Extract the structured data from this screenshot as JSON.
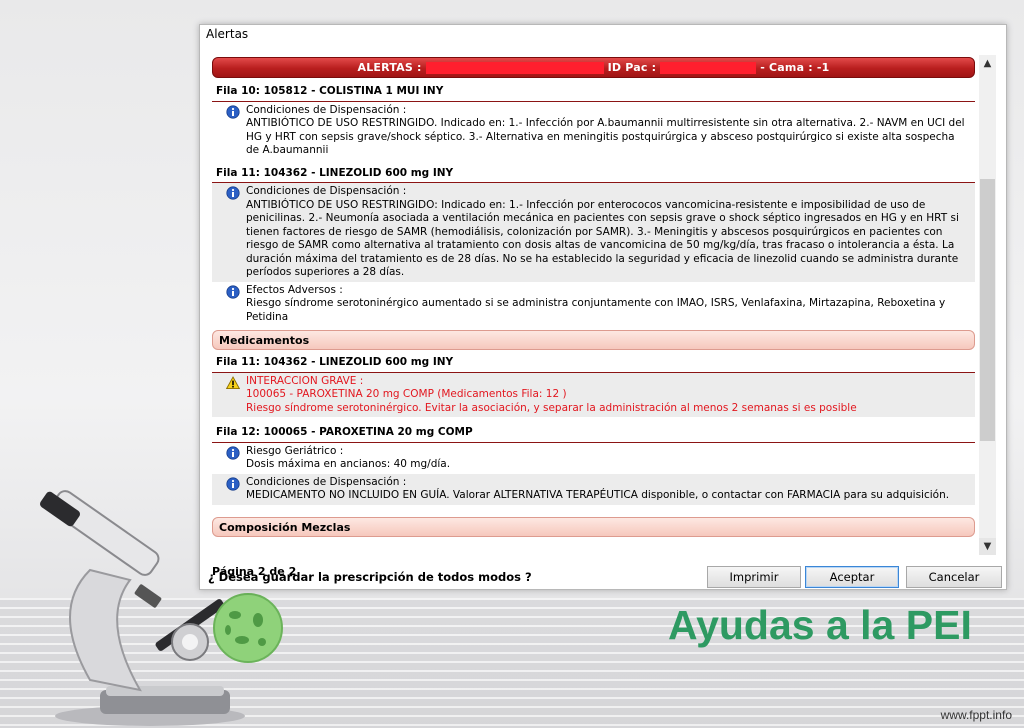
{
  "window": {
    "title": "Alertas"
  },
  "banner": {
    "alertas_label": "ALERTAS :",
    "id_pac_label": "ID Pac :",
    "cama_label": "- Cama : -1"
  },
  "blocks": {
    "fila10": {
      "header": "Fila 10: 105812 - COLISTINA 1 MUI INY",
      "condiciones_title": "Condiciones de Dispensación :",
      "condiciones_text": "ANTIBIÓTICO DE USO RESTRINGIDO. Indicado en: 1.- Infección por A.baumannii multirresistente sin otra alternativa. 2.- NAVM en UCI del HG y HRT con sepsis grave/shock séptico. 3.- Alternativa en meningitis postquirúrgica y absceso postquirúrgico si existe alta sospecha de A.baumannii"
    },
    "fila11": {
      "header": "Fila 11: 104362 - LINEZOLID 600 mg INY",
      "condiciones_title": "Condiciones de Dispensación :",
      "condiciones_text": "ANTIBIÓTICO DE USO RESTRINGIDO: Indicado en: 1.- Infección por enterococos vancomicina-resistente e imposibilidad de uso de penicilinas. 2.- Neumonía asociada a ventilación mecánica en pacientes con sepsis grave o shock séptico ingresados en HG y en HRT si tienen factores de riesgo de SAMR (hemodiálisis, colonización por SAMR). 3.- Meningitis y abscesos posquirúrgicos en pacientes con riesgo de SAMR como alternativa al tratamiento con dosis altas de vancomicina de 50 mg/kg/día, tras fracaso o intolerancia a ésta. La duración máxima del tratamiento es de 28 días. No se ha establecido la seguridad y eficacia de linezolid cuando se administra durante períodos superiores a 28 días.",
      "efectos_title": "Efectos Adversos :",
      "efectos_text": "Riesgo síndrome serotoninérgico aumentado si se administra conjuntamente con IMAO, ISRS, Venlafaxina, Mirtazapina, Reboxetina y Petidina"
    },
    "medicamentos_section": "Medicamentos",
    "med_fila11": {
      "header": "Fila 11: 104362 - LINEZOLID 600 mg INY",
      "interaccion_title": "INTERACCION GRAVE :",
      "interaccion_line1": "100065 - PAROXETINA 20 mg COMP (Medicamentos Fila: 12 )",
      "interaccion_line2": "Riesgo síndrome serotoninérgico. Evitar la asociación, y separar la administración al menos 2 semanas si es posible"
    },
    "med_fila12": {
      "header": "Fila 12: 100065 - PAROXETINA 20 mg COMP",
      "riesgo_title": "Riesgo Geriátrico :",
      "riesgo_text": "Dosis máxima en ancianos: 40 mg/día.",
      "condiciones_title": "Condiciones de Dispensación :",
      "condiciones_text": "MEDICAMENTO NO INCLUIDO EN GUÍA. Valorar ALTERNATIVA TERAPÉUTICA disponible, o contactar con FARMACIA para su adquisición."
    },
    "composicion_section": "Composición Mezclas"
  },
  "pagination": "Página 2 de 2",
  "question": "¿ Desea guardar la prescripción de todos modos ?",
  "buttons": {
    "imprimir": "Imprimir",
    "aceptar": "Aceptar",
    "cancelar": "Cancelar"
  },
  "slide": {
    "title": "Ayudas a la PEI",
    "url": "www.fppt.info"
  },
  "icons": {
    "info": "info-icon",
    "warning": "warning-icon"
  },
  "colors": {
    "alert_red": "#b81e1e",
    "interaction_text": "#e2171f",
    "slide_title": "#2e9a62",
    "section_bg": "#f6c8bd"
  }
}
